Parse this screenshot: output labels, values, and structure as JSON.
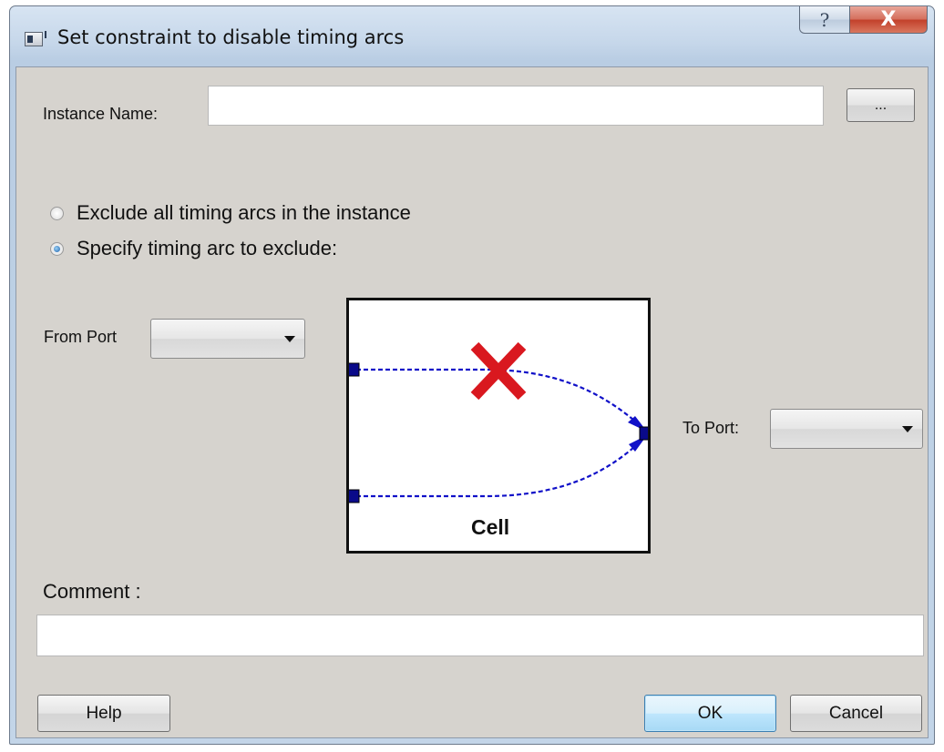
{
  "window": {
    "title": "Set constraint to disable timing arcs",
    "help_glyph": "?",
    "close_glyph": "X"
  },
  "instance": {
    "label": "Instance Name:",
    "value": "",
    "browse_label": "..."
  },
  "mode": {
    "options": [
      {
        "label": "Exclude all timing arcs in the instance",
        "selected": false
      },
      {
        "label": "Specify timing arc to exclude:",
        "selected": true
      }
    ]
  },
  "from_port": {
    "label": "From Port",
    "selected": ""
  },
  "to_port": {
    "label": "To Port:",
    "selected": ""
  },
  "diagram": {
    "cell_label": "Cell",
    "arc_color": "#1010c8",
    "pin_color": "#0a0a8a",
    "cross_color": "#d9181f"
  },
  "comment": {
    "label": "Comment :",
    "value": ""
  },
  "buttons": {
    "help": "Help",
    "ok": "OK",
    "cancel": "Cancel"
  }
}
